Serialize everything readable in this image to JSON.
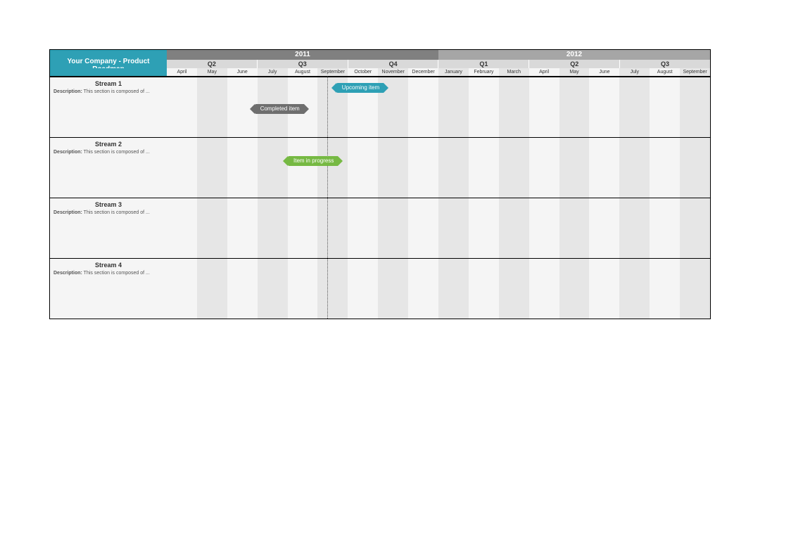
{
  "title": "Your Company - Product Roadmap",
  "years": [
    "2011",
    "2012"
  ],
  "quarters": [
    "Q2",
    "Q3",
    "Q4",
    "Q1",
    "Q2",
    "Q3"
  ],
  "months": [
    "April",
    "May",
    "June",
    "July",
    "August",
    "September",
    "October",
    "November",
    "December",
    "January",
    "February",
    "March",
    "April",
    "May",
    "June",
    "July",
    "August",
    "September"
  ],
  "desc_label": "Description:",
  "desc_text": "This section is composed of ...",
  "streams": {
    "s1": {
      "name": "Stream 1"
    },
    "s2": {
      "name": "Stream 2"
    },
    "s3": {
      "name": "Stream 3"
    },
    "s4": {
      "name": "Stream 4"
    }
  },
  "tasks": {
    "upcoming": {
      "label": "Upcoming item"
    },
    "completed": {
      "label": "Completed item"
    },
    "progress": {
      "label": "Item in progress"
    }
  }
}
